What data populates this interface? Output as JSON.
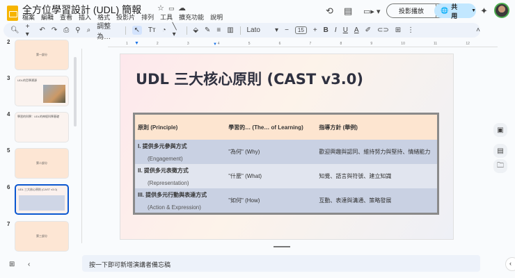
{
  "app": {
    "title": "全方位學習設計 (UDL) 簡報",
    "menu": [
      "檔案",
      "編輯",
      "查看",
      "插入",
      "格式",
      "投影片",
      "排列",
      "工具",
      "擴充功能",
      "說明"
    ],
    "present_label": "投影播放",
    "share_label": "共用"
  },
  "toolbar": {
    "zoom_label": "調整為…",
    "font": "Lato",
    "font_size": "15"
  },
  "ruler": [
    "1",
    "2",
    "3",
    "4",
    "5",
    "6",
    "7",
    "8",
    "9",
    "10",
    "11",
    "12"
  ],
  "slides": [
    {
      "num": "2",
      "text": "第一部分"
    },
    {
      "num": "3",
      "text": "UDL的哲學溯源"
    },
    {
      "num": "4",
      "text": "學習的科學：UDL的神經科學基礎"
    },
    {
      "num": "5",
      "text": "第二部分"
    },
    {
      "num": "6",
      "text": "UDL 三大核心原則 (CAST v3.0)"
    },
    {
      "num": "7",
      "text": "第三部分"
    }
  ],
  "slide": {
    "title": "UDL 三大核心原則 (CAST v3.0)",
    "headers": [
      "原則 (Principle)",
      "學習的… (The… of Learning)",
      "指導方針 (舉例)"
    ],
    "rows": [
      {
        "principle": "I. 提供多元參與方式",
        "sub": "(Engagement)",
        "what": "\"為何\" (Why)",
        "guide": "歡迎興趣與認同、維持努力與堅持、情緒能力"
      },
      {
        "principle": "II. 提供多元表徵方式",
        "sub": "(Representation)",
        "what": "\"什麼\" (What)",
        "guide": "知覺、語言與符號、建立知識"
      },
      {
        "principle": "III. 提供多元行動與表達方式",
        "sub": "(Action & Expression)",
        "what": "\"如何\" (How)",
        "guide": "互動、表達與溝通、策略發展"
      }
    ]
  },
  "notes": {
    "placeholder": "按一下即可新增演講者備忘稿"
  }
}
